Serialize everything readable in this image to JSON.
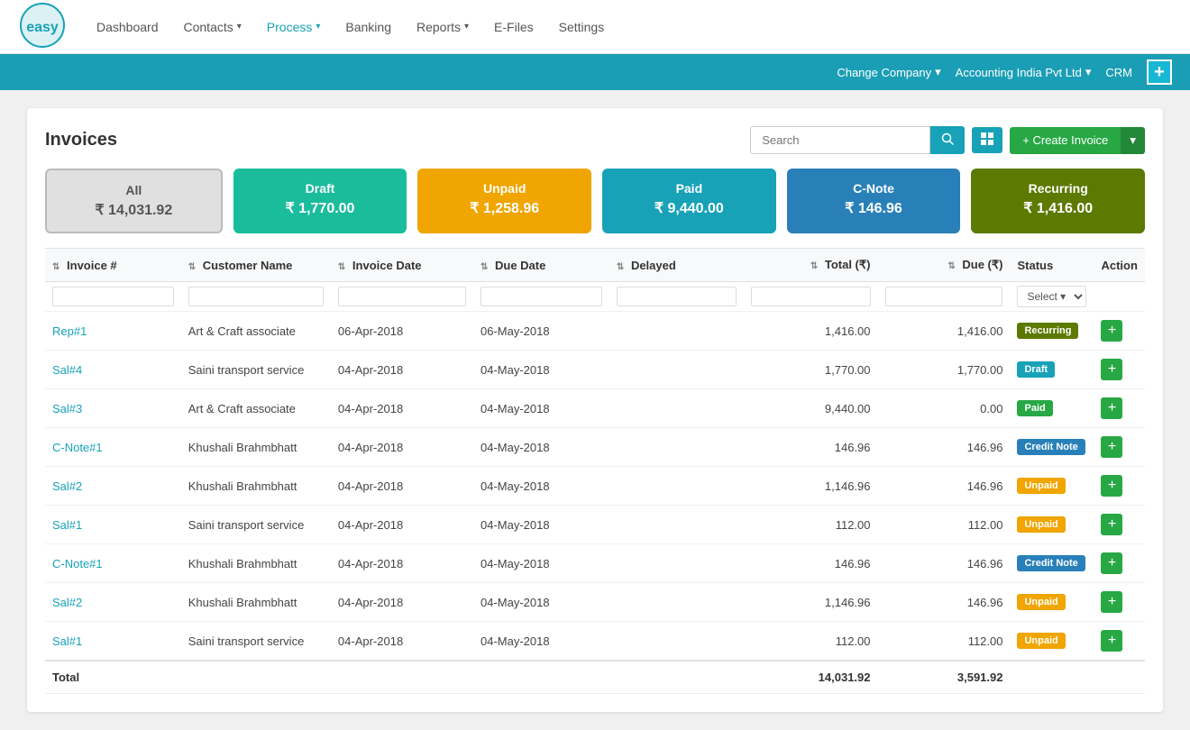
{
  "app": {
    "logo_text": "easy"
  },
  "nav": {
    "items": [
      {
        "label": "Dashboard",
        "active": false,
        "has_arrow": false
      },
      {
        "label": "Contacts",
        "active": false,
        "has_arrow": true
      },
      {
        "label": "Process",
        "active": true,
        "has_arrow": true
      },
      {
        "label": "Banking",
        "active": false,
        "has_arrow": false
      },
      {
        "label": "Reports",
        "active": false,
        "has_arrow": true
      },
      {
        "label": "E-Files",
        "active": false,
        "has_arrow": false
      },
      {
        "label": "Settings",
        "active": false,
        "has_arrow": false
      }
    ]
  },
  "secondary_nav": {
    "change_company": "Change Company",
    "company_name": "Accounting India Pvt Ltd",
    "crm": "CRM"
  },
  "page": {
    "title": "Invoices",
    "search_placeholder": "Search"
  },
  "summary_cards": [
    {
      "key": "all",
      "label": "All",
      "amount": "₹ 14,031.92"
    },
    {
      "key": "draft",
      "label": "Draft",
      "amount": "₹ 1,770.00"
    },
    {
      "key": "unpaid",
      "label": "Unpaid",
      "amount": "₹ 1,258.96"
    },
    {
      "key": "paid",
      "label": "Paid",
      "amount": "₹ 9,440.00"
    },
    {
      "key": "cnote",
      "label": "C-Note",
      "amount": "₹ 146.96"
    },
    {
      "key": "recurring",
      "label": "Recurring",
      "amount": "₹ 1,416.00"
    }
  ],
  "table": {
    "columns": [
      {
        "label": "Invoice #",
        "key": "invoice_num",
        "sortable": true
      },
      {
        "label": "Customer Name",
        "key": "customer_name",
        "sortable": true
      },
      {
        "label": "Invoice Date",
        "key": "invoice_date",
        "sortable": true
      },
      {
        "label": "Due Date",
        "key": "due_date",
        "sortable": true
      },
      {
        "label": "Delayed",
        "key": "delayed",
        "sortable": true
      },
      {
        "label": "Total (₹)",
        "key": "total",
        "sortable": true
      },
      {
        "label": "Due (₹)",
        "key": "due",
        "sortable": true
      },
      {
        "label": "Status",
        "key": "status",
        "sortable": false
      },
      {
        "label": "Action",
        "key": "action",
        "sortable": false
      }
    ],
    "rows": [
      {
        "invoice_num": "Rep#1",
        "customer_name": "Art & Craft associate",
        "invoice_date": "06-Apr-2018",
        "due_date": "06-May-2018",
        "delayed": "",
        "total": "1,416.00",
        "due": "1,416.00",
        "status": "Recurring",
        "status_class": "badge-recurring"
      },
      {
        "invoice_num": "Sal#4",
        "customer_name": "Saini transport service",
        "invoice_date": "04-Apr-2018",
        "due_date": "04-May-2018",
        "delayed": "",
        "total": "1,770.00",
        "due": "1,770.00",
        "status": "Draft",
        "status_class": "badge-draft"
      },
      {
        "invoice_num": "Sal#3",
        "customer_name": "Art & Craft associate",
        "invoice_date": "04-Apr-2018",
        "due_date": "04-May-2018",
        "delayed": "",
        "total": "9,440.00",
        "due": "0.00",
        "status": "Paid",
        "status_class": "badge-paid"
      },
      {
        "invoice_num": "C-Note#1",
        "customer_name": "Khushali Brahmbhatt",
        "invoice_date": "04-Apr-2018",
        "due_date": "04-May-2018",
        "delayed": "",
        "total": "146.96",
        "due": "146.96",
        "status": "Credit Note",
        "status_class": "badge-credit-note"
      },
      {
        "invoice_num": "Sal#2",
        "customer_name": "Khushali Brahmbhatt",
        "invoice_date": "04-Apr-2018",
        "due_date": "04-May-2018",
        "delayed": "",
        "total": "1,146.96",
        "due": "146.96",
        "status": "Unpaid",
        "status_class": "badge-unpaid"
      },
      {
        "invoice_num": "Sal#1",
        "customer_name": "Saini transport service",
        "invoice_date": "04-Apr-2018",
        "due_date": "04-May-2018",
        "delayed": "",
        "total": "112.00",
        "due": "112.00",
        "status": "Unpaid",
        "status_class": "badge-unpaid"
      },
      {
        "invoice_num": "C-Note#1",
        "customer_name": "Khushali Brahmbhatt",
        "invoice_date": "04-Apr-2018",
        "due_date": "04-May-2018",
        "delayed": "",
        "total": "146.96",
        "due": "146.96",
        "status": "Credit Note",
        "status_class": "badge-credit-note"
      },
      {
        "invoice_num": "Sal#2",
        "customer_name": "Khushali Brahmbhatt",
        "invoice_date": "04-Apr-2018",
        "due_date": "04-May-2018",
        "delayed": "",
        "total": "1,146.96",
        "due": "146.96",
        "status": "Unpaid",
        "status_class": "badge-unpaid"
      },
      {
        "invoice_num": "Sal#1",
        "customer_name": "Saini transport service",
        "invoice_date": "04-Apr-2018",
        "due_date": "04-May-2018",
        "delayed": "",
        "total": "112.00",
        "due": "112.00",
        "status": "Unpaid",
        "status_class": "badge-unpaid"
      }
    ],
    "totals": {
      "label": "Total",
      "total": "14,031.92",
      "due": "3,591.92"
    }
  },
  "buttons": {
    "create_invoice": "+ Create Invoice",
    "search": "🔍",
    "select_placeholder": "Select ▾"
  }
}
